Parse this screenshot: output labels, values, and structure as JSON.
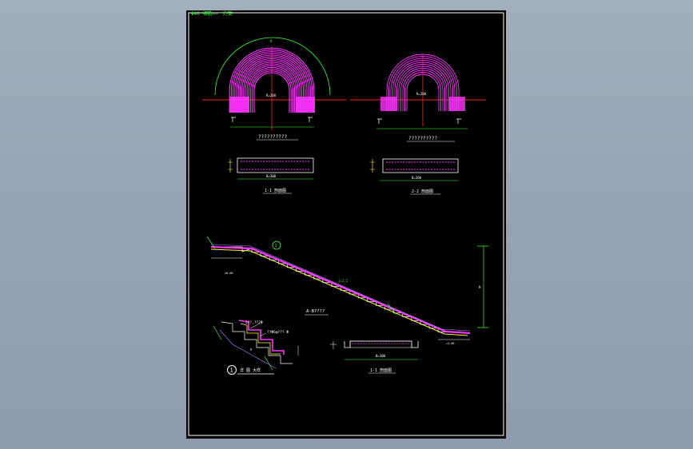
{
  "sheet": {
    "title": "Φ40 钢筋——一方案",
    "colors": {
      "background": "#000000",
      "frame": "#ffffff",
      "stair_rebar": "#ff33ff",
      "green_dims": "#33ff33",
      "axis_line": "#ff2222",
      "concrete_line": "#ffff33",
      "blue_fill": "#9999ff",
      "viewport_bg": "#98a4b4"
    }
  },
  "plans": {
    "left": {
      "caption": "??????????",
      "center_label": "R=200",
      "radius_label": "R"
    },
    "right": {
      "caption": "??????????",
      "center_label": "R=200",
      "radius_label": "R"
    }
  },
  "sections": {
    "left": {
      "caption": "1-1 剖面图",
      "width_label": "B=300"
    },
    "right": {
      "caption": "2-2 剖面图",
      "width_label": "B=300"
    }
  },
  "stair": {
    "caption": "A-B????",
    "detail_marker": "1",
    "slope_label": "i=1:2",
    "floor_tag_left": "±0.00",
    "floor_tag_right": "+3.60",
    "height_dim": "H"
  },
  "detail": {
    "number": "1",
    "caption": "详 图 大样",
    "note_1": "2??,??2Φ",
    "note_2": "??Φ6@??? Φ",
    "dim_label": "h"
  },
  "bottom_section": {
    "caption": "1-1 剖面图",
    "width_label": "B=300"
  }
}
